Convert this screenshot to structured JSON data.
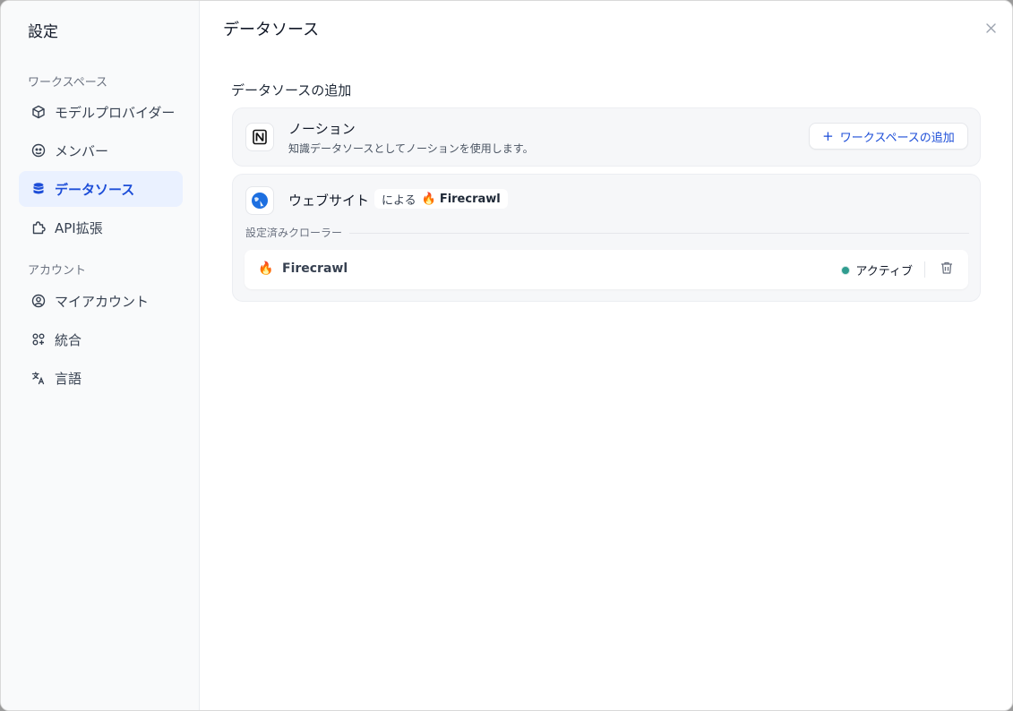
{
  "sidebar": {
    "title": "設定",
    "workspace_label": "ワークスペース",
    "account_label": "アカウント",
    "workspace_items": [
      {
        "label": "モデルプロバイダー",
        "icon": "cube-icon"
      },
      {
        "label": "メンバー",
        "icon": "members-icon"
      },
      {
        "label": "データソース",
        "icon": "database-icon",
        "active": true
      },
      {
        "label": "API拡張",
        "icon": "puzzle-icon"
      }
    ],
    "account_items": [
      {
        "label": "マイアカウント",
        "icon": "user-circle-icon"
      },
      {
        "label": "統合",
        "icon": "integrations-icon"
      },
      {
        "label": "言語",
        "icon": "translate-icon"
      }
    ]
  },
  "main": {
    "title": "データソース",
    "close_icon": "close-icon",
    "section_title": "データソースの追加",
    "notion": {
      "name": "ノーション",
      "description": "知識データソースとしてノーションを使用します。",
      "add_button": "ワークスペースの追加"
    },
    "website": {
      "name": "ウェブサイト",
      "by_label": "による",
      "provider": "Firecrawl",
      "configured_label": "設定済みクローラー",
      "crawler": {
        "name": "Firecrawl",
        "status": "アクティブ",
        "status_color": "#2f9c8f"
      }
    }
  },
  "colors": {
    "accent": "#1d4ed8",
    "active_bg": "#eaf1ff"
  }
}
